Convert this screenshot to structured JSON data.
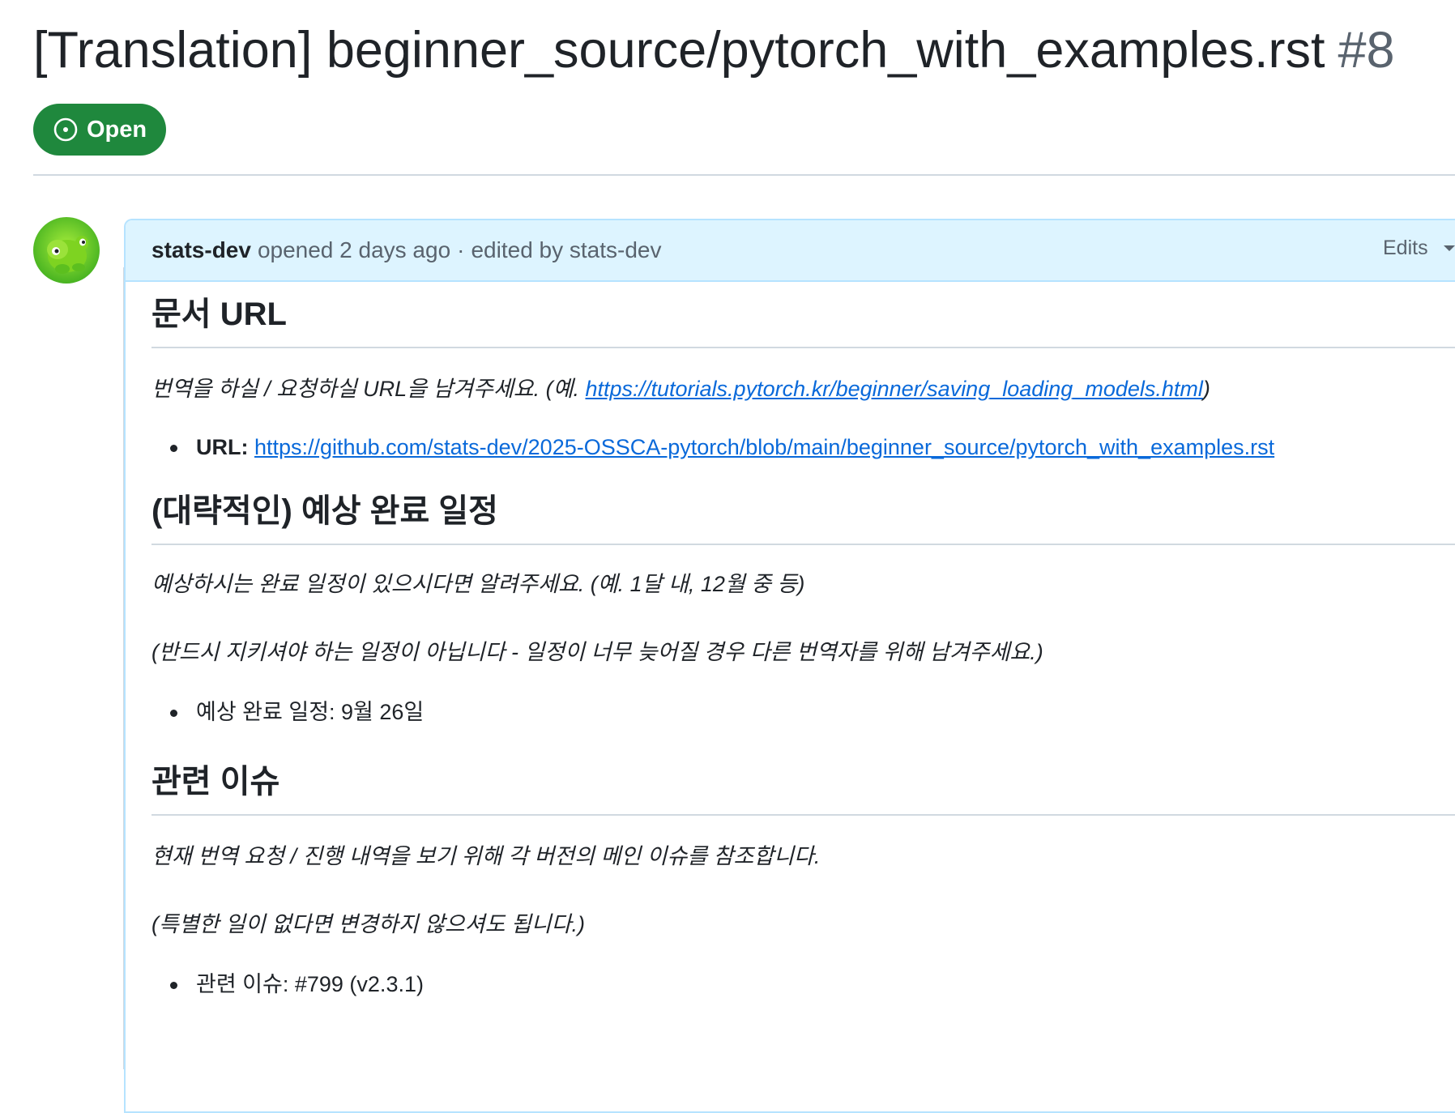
{
  "issue": {
    "title": "[Translation] beginner_source/pytorch_with_examples.rst",
    "number": "#8",
    "state": "Open"
  },
  "comment": {
    "author": "stats-dev",
    "action": "opened",
    "time": "2 days ago",
    "separator": "·",
    "edited_text": "edited by stats-dev",
    "edits_label": "Edits"
  },
  "sections": {
    "doc_url": {
      "heading": "문서 URL",
      "description_prefix": "번역을 하실 / 요청하실 URL을 남겨주세요. (예. ",
      "description_link": "https://tutorials.pytorch.kr/beginner/saving_loading_models.html",
      "description_suffix": ")",
      "item_label": "URL:",
      "item_link": "https://github.com/stats-dev/2025-OSSCA-pytorch/blob/main/beginner_source/pytorch_with_examples.rst"
    },
    "schedule": {
      "heading": "(대략적인) 예상 완료 일정",
      "description_1": "예상하시는 완료 일정이 있으시다면 알려주세요. (예. 1달 내, 12월 중 등)",
      "description_2": "(반드시 지키셔야 하는 일정이 아닙니다 - 일정이 너무 늦어질 경우 다른 번역자를 위해 남겨주세요.)",
      "item": "예상 완료 일정: 9월 26일"
    },
    "related": {
      "heading": "관련 이슈",
      "description_1": "현재 번역 요청 / 진행 내역을 보기 위해 각 버전의 메인 이슈를 참조합니다.",
      "description_2": "(특별한 일이 없다면 변경하지 않으셔도 됩니다.)",
      "item": "관련 이슈: #799 (v2.3.1)"
    }
  },
  "colors": {
    "open_badge": "#1f883d",
    "header_bg": "#ddf4ff",
    "header_border": "#b6e3ff",
    "link": "#0969da",
    "muted": "#59636e",
    "avatar_green": "#7ed321"
  }
}
